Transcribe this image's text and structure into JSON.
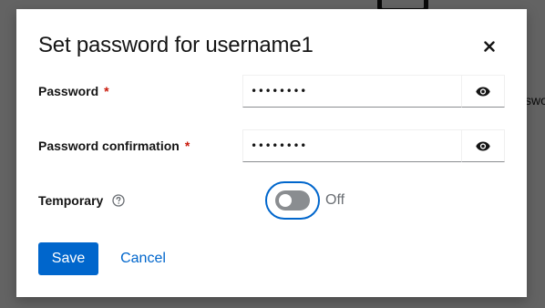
{
  "background": {
    "partial_text": "swo"
  },
  "modal": {
    "title": "Set password for username1",
    "close_label": "×",
    "password": {
      "label": "Password",
      "required_marker": "*",
      "value": "••••••••",
      "toggle_icon": "eye-icon"
    },
    "password_confirmation": {
      "label": "Password confirmation",
      "required_marker": "*",
      "value": "••••••••",
      "toggle_icon": "eye-icon"
    },
    "temporary": {
      "label": "Temporary",
      "help_icon": "help-circle-icon",
      "switch_state": "Off",
      "checked": false
    },
    "actions": {
      "save_label": "Save",
      "cancel_label": "Cancel"
    }
  },
  "colors": {
    "primary": "#0066cc",
    "required": "#c9190b",
    "switch_off": "#8a8d90",
    "text": "#151515"
  }
}
